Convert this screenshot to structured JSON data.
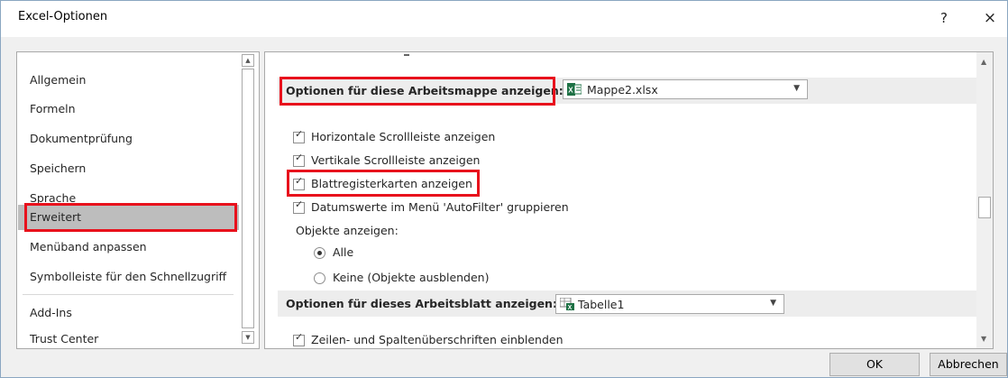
{
  "window": {
    "title": "Excel-Optionen",
    "help_label": "?",
    "close_label": "×"
  },
  "sidebar": {
    "items": [
      {
        "label": "Allgemein"
      },
      {
        "label": "Formeln"
      },
      {
        "label": "Dokumentprüfung"
      },
      {
        "label": "Speichern"
      },
      {
        "label": "Sprache"
      },
      {
        "label": "Erweitert",
        "selected": true
      },
      {
        "label": "Menüband anpassen"
      },
      {
        "label": "Symbolleiste für den Schnellzugriff"
      },
      {
        "label": "Add-Ins"
      },
      {
        "label": "Trust Center"
      }
    ]
  },
  "workbook_section": {
    "label": "Optionen für diese Arbeitsmappe anzeigen:",
    "selected_workbook": "Mappe2.xlsx",
    "options": [
      {
        "label": "Horizontale Scrollleiste anzeigen",
        "checked": true
      },
      {
        "label": "Vertikale Scrollleiste anzeigen",
        "checked": true
      },
      {
        "label": "Blattregisterkarten anzeigen",
        "checked": true
      },
      {
        "label": "Datumswerte im Menü 'AutoFilter' gruppieren",
        "checked": true
      }
    ],
    "objects_label": "Objekte anzeigen:",
    "objects_radio": [
      {
        "label": "Alle",
        "selected": true
      },
      {
        "label": "Keine (Objekte ausblenden)",
        "selected": false
      }
    ]
  },
  "sheet_section": {
    "label": "Optionen für dieses Arbeitsblatt anzeigen:",
    "selected_sheet": "Tabelle1",
    "options": [
      {
        "label": "Zeilen- und Spaltenüberschriften einblenden",
        "checked": true
      }
    ]
  },
  "footer": {
    "ok_label": "OK",
    "cancel_label": "Abbrechen"
  },
  "colors": {
    "highlight": "#e8111c",
    "selected_nav": "#bdbdbd",
    "excel_green": "#1e7145"
  },
  "icons": {
    "workbook": "excel-workbook-icon",
    "sheet": "excel-sheet-icon"
  }
}
